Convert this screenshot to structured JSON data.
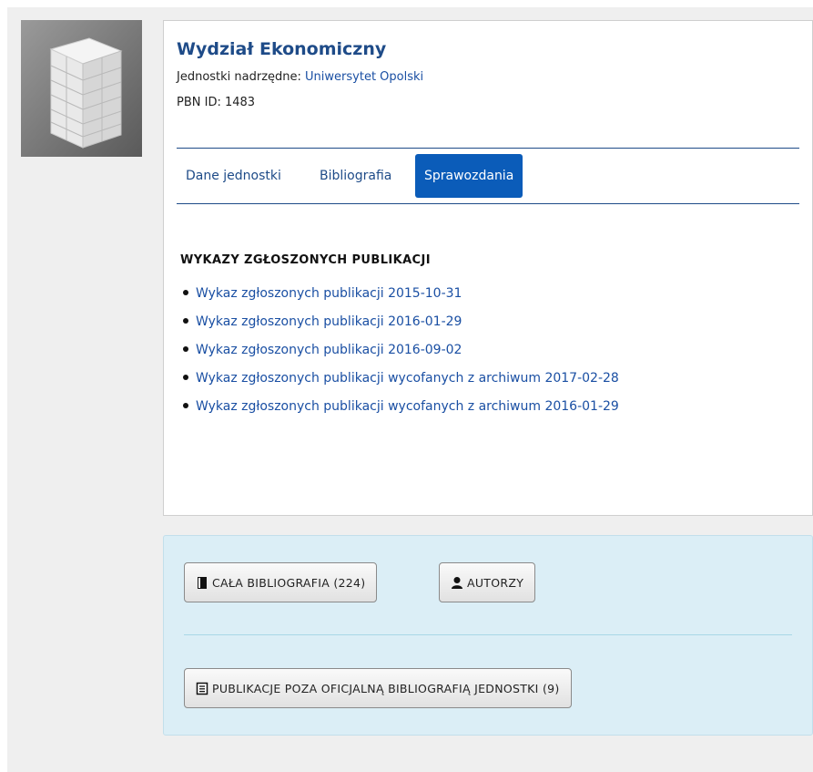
{
  "unit": {
    "name": "Wydział Ekonomiczny",
    "parent_label": "Jednostki nadrzędne: ",
    "parent_link": "Uniwersytet Opolski",
    "pbn_label": "PBN ID: ",
    "pbn_id": "1483"
  },
  "tabs": [
    {
      "label": "Dane jednostki",
      "active": false
    },
    {
      "label": "Bibliografia",
      "active": false
    },
    {
      "label": "Sprawozdania",
      "active": true
    }
  ],
  "reports": {
    "heading": "WYKAZY ZGŁOSZONYCH PUBLIKACJI",
    "items": [
      "Wykaz zgłoszonych publikacji 2015-10-31",
      "Wykaz zgłoszonych publikacji 2016-01-29",
      "Wykaz zgłoszonych publikacji 2016-09-02",
      "Wykaz zgłoszonych publikacji wycofanych z archiwum 2017-02-28",
      "Wykaz zgłoszonych publikacji wycofanych z archiwum 2016-01-29"
    ]
  },
  "actions": {
    "full_bibliography": "CAŁA BIBLIOGRAFIA (224)",
    "authors": "AUTORZY",
    "outside_publications": "PUBLIKACJE POZA OFICJALNĄ BIBLIOGRAFIĄ JEDNOSTKI (9)"
  },
  "icons": {
    "unit_image": "office-building-icon",
    "full_bibliography": "book-icon",
    "authors": "user-icon",
    "outside_publications": "list-icon"
  },
  "colors": {
    "title": "#1e4b88",
    "link": "#1a4fa3",
    "active_tab": "#0b5cb9",
    "actions_bg": "#dbeef6"
  }
}
